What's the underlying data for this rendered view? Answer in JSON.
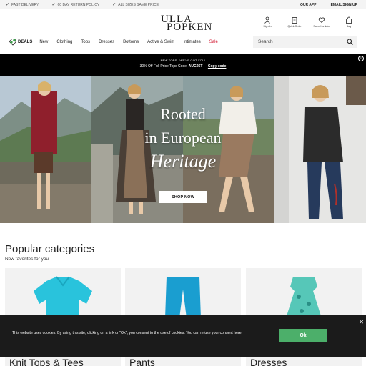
{
  "utility": {
    "perks": [
      "FAST DELIVERY",
      "60 DAY RETURN POLICY",
      "ALL SIZES SAME PRICE"
    ],
    "links": [
      "OUR APP",
      "EMAIL SIGN UP"
    ]
  },
  "header": {
    "logo_line1": "ULLA",
    "logo_line2": "POPKEN",
    "icons": [
      {
        "label": "Sign In",
        "icon": "user-icon"
      },
      {
        "label": "Quick Order",
        "icon": "clipboard-icon"
      },
      {
        "label": "Saved for later",
        "icon": "heart-icon"
      },
      {
        "label": "Bag",
        "icon": "bag-icon"
      }
    ]
  },
  "nav": {
    "deals": "DEALS",
    "items": [
      "New",
      "Clothing",
      "Tops",
      "Dresses",
      "Bottoms",
      "Active & Swim",
      "Intimates"
    ],
    "sale": "Sale",
    "search_placeholder": "Search"
  },
  "promo": {
    "eyebrow": "NEW TOPS - WE'VE GOT YOU!",
    "offer": "30% Off Full Price Tops Code:",
    "code": "AUG26T",
    "copy_label": "Copy code"
  },
  "hero": {
    "line1": "Rooted",
    "line2": "in European",
    "line3": "Heritage",
    "cta": "SHOP NOW"
  },
  "categories": {
    "title": "Popular categories",
    "subtitle": "New favorites for you",
    "items": [
      "Knit Tops & Tees",
      "Pants",
      "Dresses"
    ]
  },
  "cookie": {
    "text": "This website uses cookies. By using this site, clicking on a link or \"Ok\", you consent to the use of cookies. You can refuse your consent",
    "link": "here",
    "ok": "Ok"
  },
  "colors": {
    "sale": "#d0102a",
    "promo_bg": "#000000",
    "cookie_bg": "#1b1b1b",
    "ok_button": "#4caf6a"
  }
}
